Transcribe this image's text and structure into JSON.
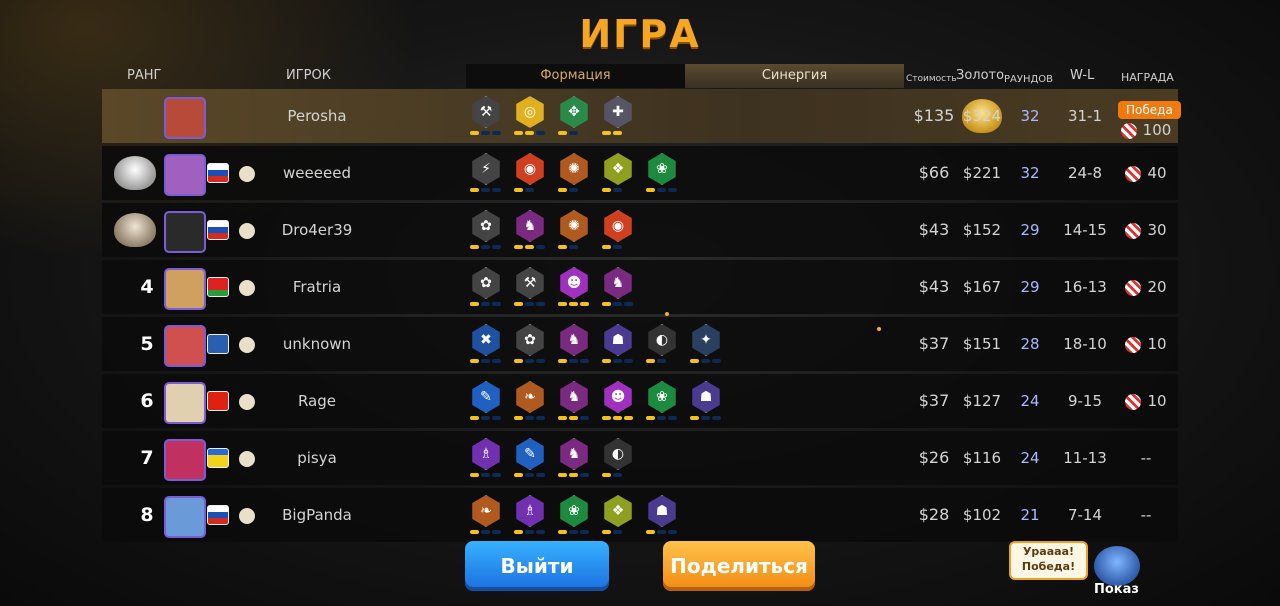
{
  "title": "ИГРА",
  "headers": {
    "rank": "РАНГ",
    "player": "ИГРОК",
    "cost": "Стоимость",
    "gold": "Золото",
    "rounds": "РАУНДОВ",
    "wl": "W-L",
    "reward": "НАГРАДА"
  },
  "tabs": {
    "formation": "Формация",
    "synergy": "Синергия"
  },
  "rows": [
    {
      "rank": "",
      "name": "Perosha",
      "cost": "$135",
      "gold": "$324",
      "rounds": "32",
      "wl": "31-1",
      "reward": "100",
      "badge": "Победа",
      "syn": [
        [
          "#444",
          "⚒",
          [
            1,
            0,
            0
          ]
        ],
        [
          "#e0b020",
          "◎",
          [
            1,
            1,
            0
          ]
        ],
        [
          "#2a8a4a",
          "✥",
          [
            1,
            0
          ]
        ],
        [
          "#556",
          "✚",
          [
            1,
            1
          ]
        ]
      ]
    },
    {
      "rank": "",
      "name": "weeeeed",
      "cost": "$66",
      "gold": "$221",
      "rounds": "32",
      "wl": "24-8",
      "reward": "40",
      "syn": [
        [
          "#444",
          "⚡",
          [
            1,
            0,
            0
          ]
        ],
        [
          "#d04020",
          "◉",
          [
            1,
            0
          ]
        ],
        [
          "#b05a20",
          "✺",
          [
            1,
            0
          ]
        ],
        [
          "#8fa020",
          "❖",
          [
            1,
            0
          ]
        ],
        [
          "#1e8a40",
          "❀",
          [
            1,
            0,
            0
          ]
        ]
      ]
    },
    {
      "rank": "",
      "name": "Dro4er39",
      "cost": "$43",
      "gold": "$152",
      "rounds": "29",
      "wl": "14-15",
      "reward": "30",
      "syn": [
        [
          "#444",
          "✿",
          [
            1,
            0,
            0
          ]
        ],
        [
          "#7a2a80",
          "♞",
          [
            1,
            1,
            0
          ]
        ],
        [
          "#b05a20",
          "✺",
          [
            1,
            0
          ]
        ],
        [
          "#d04020",
          "◉",
          [
            1,
            0
          ]
        ]
      ]
    },
    {
      "rank": "4",
      "name": "Fratria",
      "cost": "$43",
      "gold": "$167",
      "rounds": "29",
      "wl": "16-13",
      "reward": "20",
      "syn": [
        [
          "#444",
          "✿",
          [
            1,
            0,
            0
          ]
        ],
        [
          "#444",
          "⚒",
          [
            1,
            0,
            0
          ]
        ],
        [
          "#a030c0",
          "☻",
          [
            1,
            1,
            1
          ]
        ],
        [
          "#7a2a80",
          "♞",
          [
            1,
            0,
            0
          ]
        ]
      ]
    },
    {
      "rank": "5",
      "name": "unknown",
      "cost": "$37",
      "gold": "$151",
      "rounds": "28",
      "wl": "18-10",
      "reward": "10",
      "syn": [
        [
          "#2050a0",
          "✖",
          [
            1,
            0,
            0
          ]
        ],
        [
          "#444",
          "✿",
          [
            1,
            0,
            0
          ]
        ],
        [
          "#7a2a80",
          "♞",
          [
            1,
            0,
            0
          ]
        ],
        [
          "#4a3a90",
          "☗",
          [
            1,
            0,
            0
          ]
        ],
        [
          "#333",
          "◐",
          [
            1,
            0
          ]
        ],
        [
          "#2a4060",
          "✦",
          [
            1,
            0,
            0
          ]
        ]
      ]
    },
    {
      "rank": "6",
      "name": "Rage",
      "cost": "$37",
      "gold": "$127",
      "rounds": "24",
      "wl": "9-15",
      "reward": "10",
      "syn": [
        [
          "#2060c0",
          "✎",
          [
            1,
            0,
            0
          ]
        ],
        [
          "#b05a20",
          "❧",
          [
            1,
            0,
            0
          ]
        ],
        [
          "#7a2a80",
          "♞",
          [
            1,
            1,
            0
          ]
        ],
        [
          "#a030c0",
          "☻",
          [
            1,
            1,
            1
          ]
        ],
        [
          "#1e8a40",
          "❀",
          [
            1,
            0,
            0
          ]
        ],
        [
          "#4a3a90",
          "☗",
          [
            1,
            0,
            0
          ]
        ]
      ]
    },
    {
      "rank": "7",
      "name": "pisya",
      "cost": "$26",
      "gold": "$116",
      "rounds": "24",
      "wl": "11-13",
      "reward": "--",
      "syn": [
        [
          "#7030b0",
          "♗",
          [
            1,
            0,
            0
          ]
        ],
        [
          "#2060c0",
          "✎",
          [
            1,
            0,
            0
          ]
        ],
        [
          "#7a2a80",
          "♞",
          [
            1,
            1,
            0
          ]
        ],
        [
          "#333",
          "◐",
          [
            1,
            0
          ]
        ]
      ]
    },
    {
      "rank": "8",
      "name": "BigPanda",
      "cost": "$28",
      "gold": "$102",
      "rounds": "21",
      "wl": "7-14",
      "reward": "--",
      "syn": [
        [
          "#b05a20",
          "❧",
          [
            1,
            0,
            0
          ]
        ],
        [
          "#7030b0",
          "♗",
          [
            1,
            0,
            0
          ]
        ],
        [
          "#1e8a40",
          "❀",
          [
            1,
            0,
            0
          ]
        ],
        [
          "#8fa020",
          "❖",
          [
            1,
            0
          ]
        ],
        [
          "#4a3a90",
          "☗",
          [
            1,
            0,
            0
          ]
        ]
      ]
    }
  ],
  "medals": [
    "gold",
    "silver",
    "bronze"
  ],
  "buttons": {
    "exit": "Выйти",
    "share": "Поделиться"
  },
  "speech": {
    "line1": "Урaaaa!",
    "line2": "Победа!"
  },
  "show_label": "Показ"
}
